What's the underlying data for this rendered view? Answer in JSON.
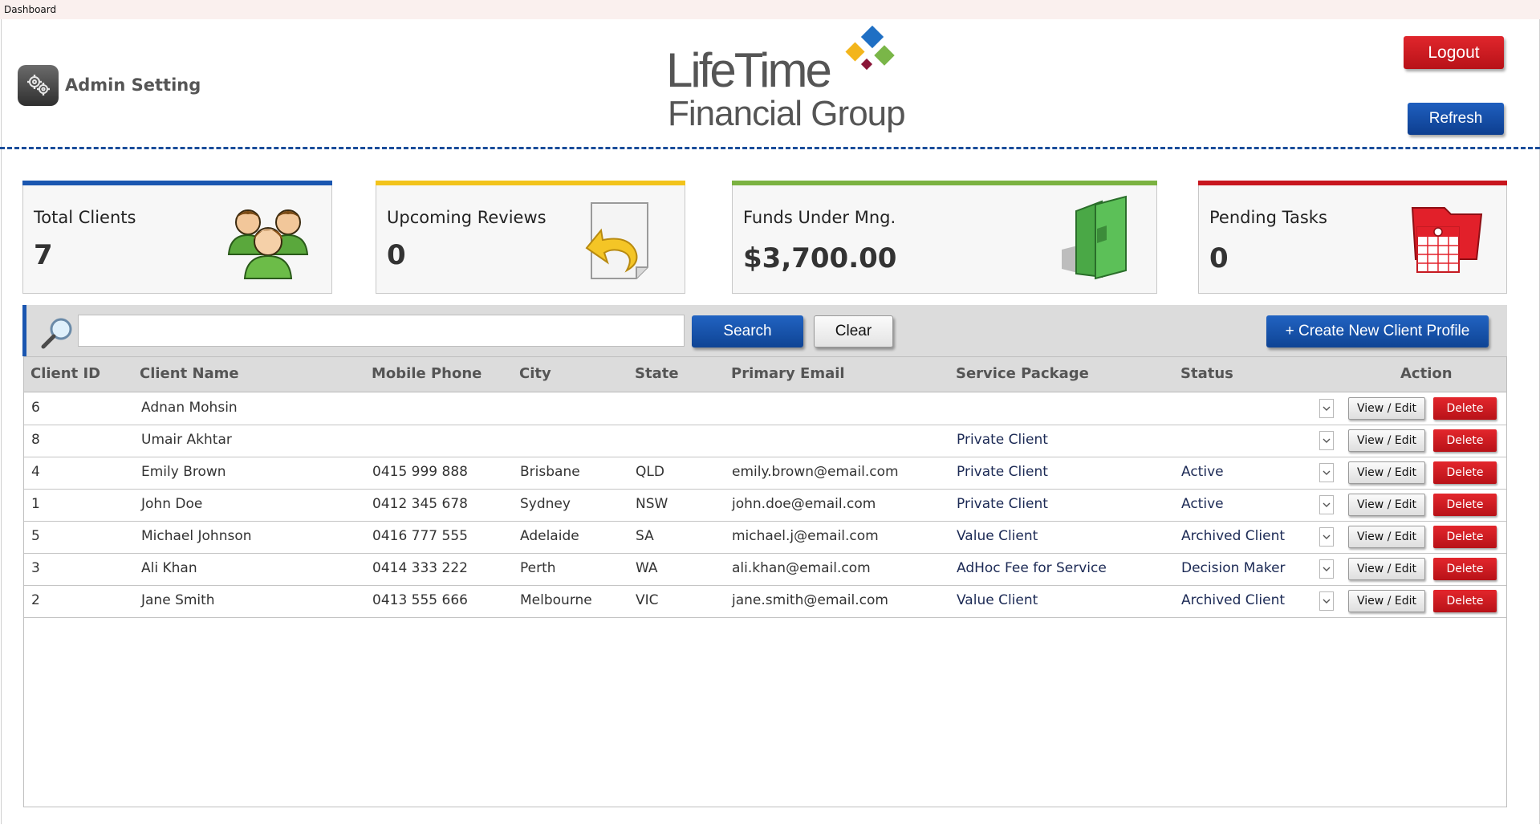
{
  "window": {
    "title": "Dashboard"
  },
  "header": {
    "admin_label": "Admin Setting",
    "logo_line1": "LifeTime",
    "logo_line2": "Financial Group",
    "logout_label": "Logout",
    "refresh_label": "Refresh"
  },
  "colors": {
    "blue": "#1a56b0",
    "yellow": "#f2c31b",
    "green": "#7bb241",
    "red": "#c8161e"
  },
  "cards": [
    {
      "title": "Total Clients",
      "value": "7",
      "icon": "users-group-icon"
    },
    {
      "title": "Upcoming Reviews",
      "value": "0",
      "icon": "review-arrow-icon"
    },
    {
      "title": "Funds Under Mng.",
      "value": "$3,700.00",
      "icon": "green-folder-icon"
    },
    {
      "title": "Pending Tasks",
      "value": "0",
      "icon": "calendar-task-icon"
    }
  ],
  "search": {
    "value": "",
    "placeholder": "",
    "search_label": "Search",
    "clear_label": "Clear",
    "create_label": "+ Create New Client Profile"
  },
  "table": {
    "headers": [
      "Client ID",
      "Client Name",
      "Mobile Phone",
      "City",
      "State",
      "Primary Email",
      "Service Package",
      "Status",
      "Action"
    ],
    "view_label": "View / Edit",
    "delete_label": "Delete",
    "rows": [
      {
        "id": "6",
        "name": "Adnan Mohsin",
        "phone": "",
        "city": "",
        "state": "",
        "email": "",
        "package": "",
        "status": ""
      },
      {
        "id": "8",
        "name": "Umair Akhtar",
        "phone": "",
        "city": "",
        "state": "",
        "email": "",
        "package": "Private Client",
        "status": ""
      },
      {
        "id": "4",
        "name": "Emily Brown",
        "phone": "0415 999 888",
        "city": "Brisbane",
        "state": "QLD",
        "email": "emily.brown@email.com",
        "package": "Private Client",
        "status": "Active"
      },
      {
        "id": "1",
        "name": "John Doe",
        "phone": "0412 345 678",
        "city": "Sydney",
        "state": "NSW",
        "email": "john.doe@email.com",
        "package": "Private Client",
        "status": "Active"
      },
      {
        "id": "5",
        "name": "Michael Johnson",
        "phone": "0416 777 555",
        "city": "Adelaide",
        "state": "SA",
        "email": "michael.j@email.com",
        "package": "Value Client",
        "status": "Archived Client"
      },
      {
        "id": "3",
        "name": "Ali Khan",
        "phone": "0414 333 222",
        "city": "Perth",
        "state": "WA",
        "email": "ali.khan@email.com",
        "package": "AdHoc Fee for Service",
        "status": "Decision Maker"
      },
      {
        "id": "2",
        "name": "Jane Smith",
        "phone": "0413 555 666",
        "city": "Melbourne",
        "state": "VIC",
        "email": "jane.smith@email.com",
        "package": "Value Client",
        "status": "Archived Client"
      }
    ]
  }
}
